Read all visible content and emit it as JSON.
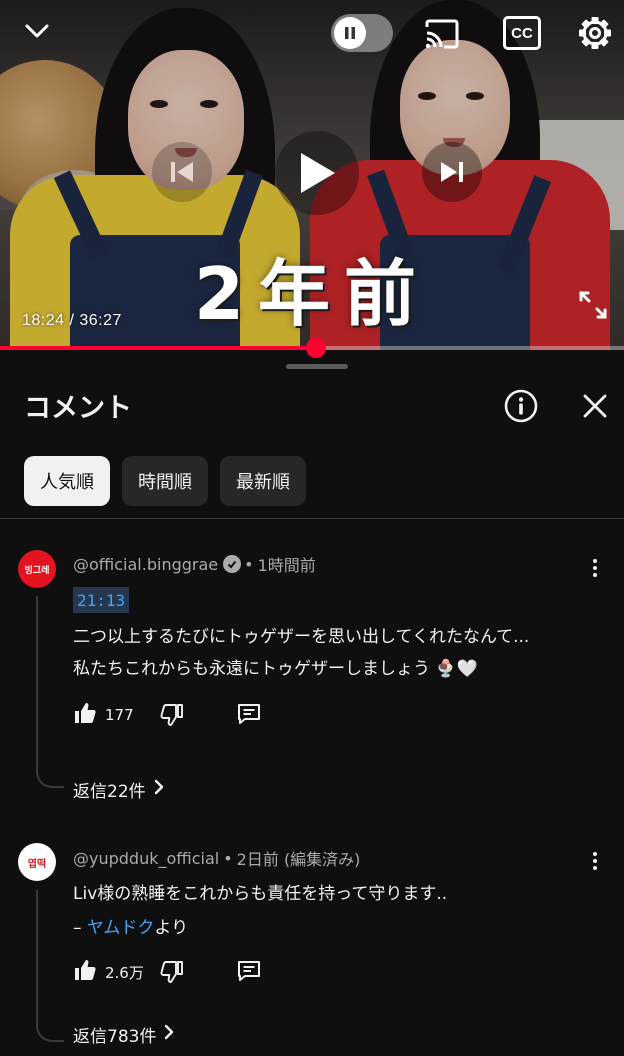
{
  "player": {
    "overlay_caption": "2年前",
    "time_display": "18:24 / 36:27",
    "progress_fraction": 0.507,
    "icons": [
      "chevron-down-icon",
      "pause-icon",
      "cast-icon",
      "captions-icon",
      "settings-icon",
      "previous-icon",
      "play-icon",
      "next-icon",
      "fullscreen-icon"
    ],
    "captions_label": "CC"
  },
  "panel": {
    "title": "コメント",
    "icons": [
      "info-icon",
      "close-icon"
    ],
    "chips": [
      {
        "label": "人気順",
        "active": true
      },
      {
        "label": "時間順",
        "active": false
      },
      {
        "label": "最新順",
        "active": false
      }
    ]
  },
  "comments": [
    {
      "author": "@official.binggrae",
      "verified": true,
      "separator": "•",
      "time": "1時間前",
      "timestamp_link": "21:13",
      "lines": [
        "二つ以上するたびにトゥゲザーを思い出してくれたなんて...",
        "私たちこれからも永遠にトゥゲザーしましょう 🍨🤍"
      ],
      "likes": "177",
      "replies_label": "返信22件",
      "avatar_text": "빙그레"
    },
    {
      "author": "@yupdduk_official",
      "verified": false,
      "separator": "•",
      "time": "2日前 (編集済み)",
      "lines": [
        "Liv様の熟睡をこれからも責任を持って守ります.."
      ],
      "signature_prefix": "– ",
      "signature_link": "ヤムドク",
      "signature_suffix": "より",
      "likes": "2.6万",
      "replies_label": "返信783件",
      "avatar_text": "엽떡"
    }
  ],
  "colors": {
    "background": "#0f0f0f",
    "accent_red": "#ff0033",
    "link_blue": "#3ea6ff",
    "chip_bg": "#272727",
    "chip_active_bg": "#f1f1f1",
    "secondary_text": "#aaaaaa"
  }
}
